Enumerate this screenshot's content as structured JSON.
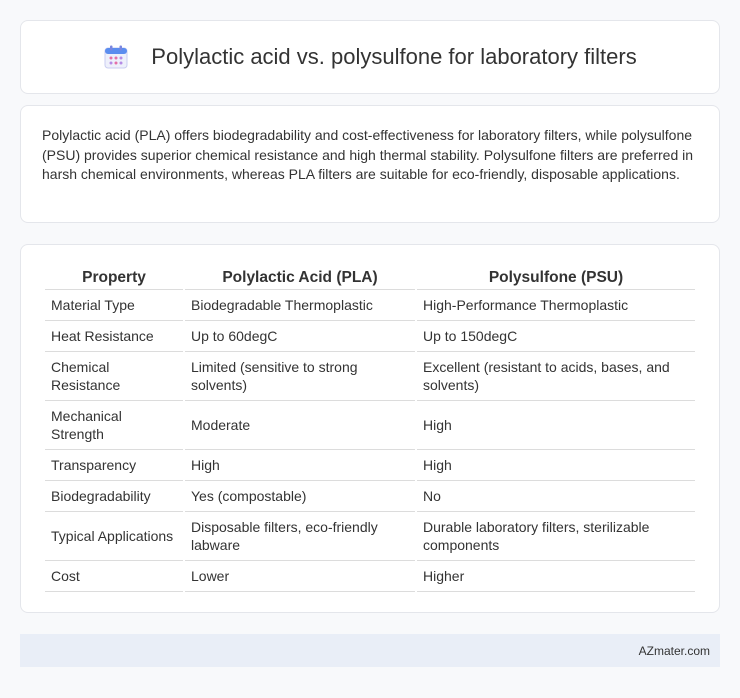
{
  "header": {
    "title": "Polylactic acid vs. polysulfone for laboratory filters",
    "icon": "calendar-icon"
  },
  "intro": {
    "text": "Polylactic acid (PLA) offers biodegradability and cost-effectiveness for laboratory filters, while polysulfone (PSU) provides superior chemical resistance and high thermal stability. Polysulfone filters are preferred in harsh chemical environments, whereas PLA filters are suitable for eco-friendly, disposable applications."
  },
  "table": {
    "headers": [
      "Property",
      "Polylactic Acid (PLA)",
      "Polysulfone (PSU)"
    ],
    "rows": [
      [
        "Material Type",
        "Biodegradable Thermoplastic",
        "High-Performance Thermoplastic"
      ],
      [
        "Heat Resistance",
        "Up to 60degC",
        "Up to 150degC"
      ],
      [
        "Chemical Resistance",
        "Limited (sensitive to strong solvents)",
        "Excellent (resistant to acids, bases, and solvents)"
      ],
      [
        "Mechanical Strength",
        "Moderate",
        "High"
      ],
      [
        "Transparency",
        "High",
        "High"
      ],
      [
        "Biodegradability",
        "Yes (compostable)",
        "No"
      ],
      [
        "Typical Applications",
        "Disposable filters, eco-friendly labware",
        "Durable laboratory filters, sterilizable components"
      ],
      [
        "Cost",
        "Lower",
        "Higher"
      ]
    ]
  },
  "footer": {
    "text": "AZmater.com"
  },
  "colors": {
    "background": "#f8f9fb",
    "card": "#ffffff",
    "footer_bg": "#e9eef7",
    "icon_accent": "#5b6bd6"
  }
}
